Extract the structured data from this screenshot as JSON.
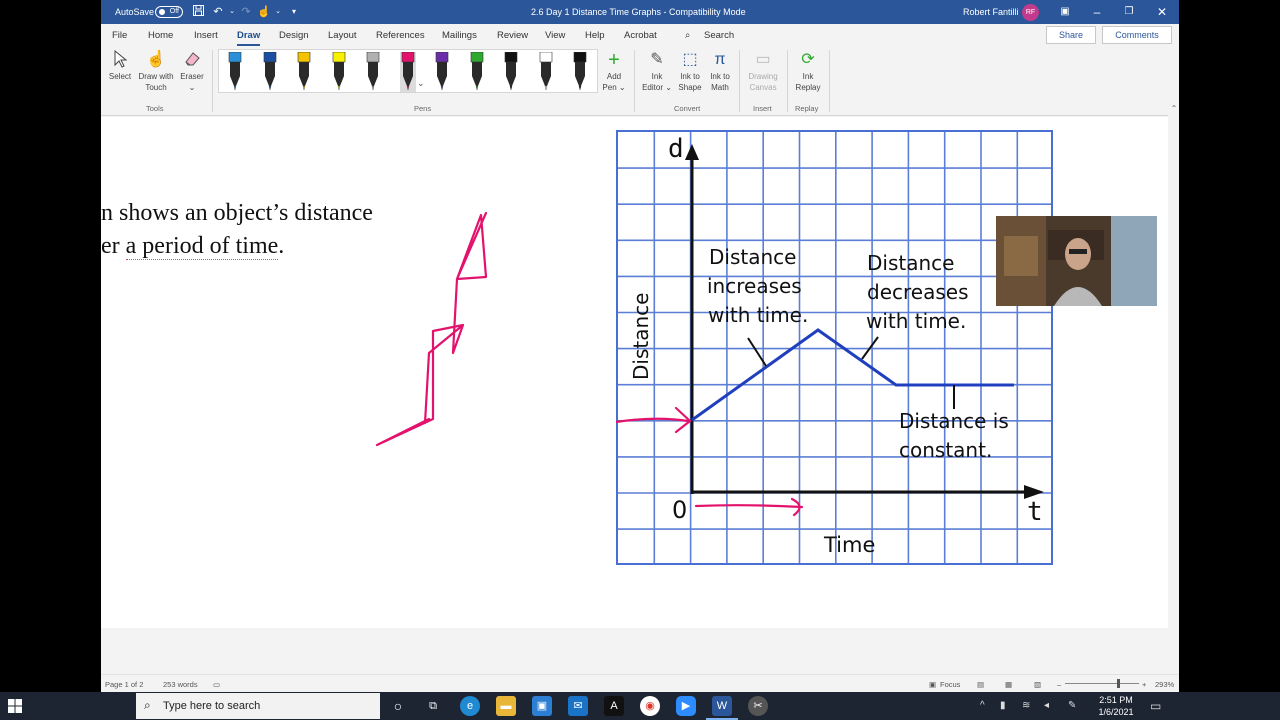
{
  "titlebar": {
    "autosave_label": "AutoSave",
    "autosave_state": "Off",
    "doc_title": "2.6 Day 1 Distance Time Graphs  -  Compatibility Mode",
    "user_name": "Robert Fantilli",
    "user_initials": "RF"
  },
  "tabs": [
    "File",
    "Home",
    "Insert",
    "Draw",
    "Design",
    "Layout",
    "References",
    "Mailings",
    "Review",
    "View",
    "Help",
    "Acrobat"
  ],
  "search_label": "Search",
  "share_label": "Share",
  "comments_label": "Comments",
  "ribbon": {
    "tools": {
      "select": "Select",
      "draw_touch_1": "Draw with",
      "draw_touch_2": "Touch",
      "eraser": "Eraser",
      "group": "Tools"
    },
    "pens_group": "Pens",
    "pens": [
      {
        "body": "#2a2a2a",
        "tip": "#2a8fd8"
      },
      {
        "body": "#2a2a2a",
        "tip": "#1c4fa0"
      },
      {
        "body": "#2a2a2a",
        "tip": "#f3c300"
      },
      {
        "body": "#2a2a2a",
        "tip": "#f8f000"
      },
      {
        "body": "#2a2a2a",
        "tip": "#b0b0b0"
      },
      {
        "body": "#2a2a2a",
        "tip": "#e3126d"
      },
      {
        "body": "#2a2a2a",
        "tip": "#6a2fa8"
      },
      {
        "body": "#2a2a2a",
        "tip": "#2ea82e"
      },
      {
        "body": "#2a2a2a",
        "tip": "#111111"
      },
      {
        "body": "#2a2a2a",
        "tip": "#ffffff"
      },
      {
        "body": "#2a2a2a",
        "tip": "#111111"
      }
    ],
    "add_pen_1": "Add",
    "add_pen_2": "Pen",
    "convert": {
      "ink_editor_1": "Ink",
      "ink_editor_2": "Editor",
      "ink_shape_1": "Ink to",
      "ink_shape_2": "Shape",
      "ink_math_1": "Ink to",
      "ink_math_2": "Math",
      "group": "Convert"
    },
    "insert": {
      "canvas_1": "Drawing",
      "canvas_2": "Canvas",
      "group": "Insert"
    },
    "replay": {
      "replay_1": "Ink",
      "replay_2": "Replay",
      "group": "Replay"
    }
  },
  "document": {
    "line1": "n shows an object’s distance",
    "line2_pre": "er ",
    "line2_ul": "a period of time",
    "line2_post": ".",
    "graph": {
      "y_axis_letter": "d",
      "y_axis_label": "Distance",
      "x_axis_letter": "t",
      "x_axis_label": "Time",
      "origin": "0",
      "annot_increase_1": "Distance",
      "annot_increase_2": "increases",
      "annot_increase_3": "with time.",
      "annot_decrease_1": "Distance",
      "annot_decrease_2": "decreases",
      "annot_decrease_3": "with time.",
      "annot_constant_1": "Distance is",
      "annot_constant_2": "constant."
    }
  },
  "statusbar": {
    "page": "Page 1 of 2",
    "words": "253 words",
    "focus": "Focus",
    "zoom": "293%"
  },
  "taskbar": {
    "search_placeholder": "Type here to search",
    "time": "2:51 PM",
    "date": "1/6/2021"
  },
  "colors": {
    "word_blue": "#2b579a",
    "ink_pink": "#e3126d",
    "graph_grid": "#5b7fd6",
    "graph_line": "#1f3fbf"
  }
}
